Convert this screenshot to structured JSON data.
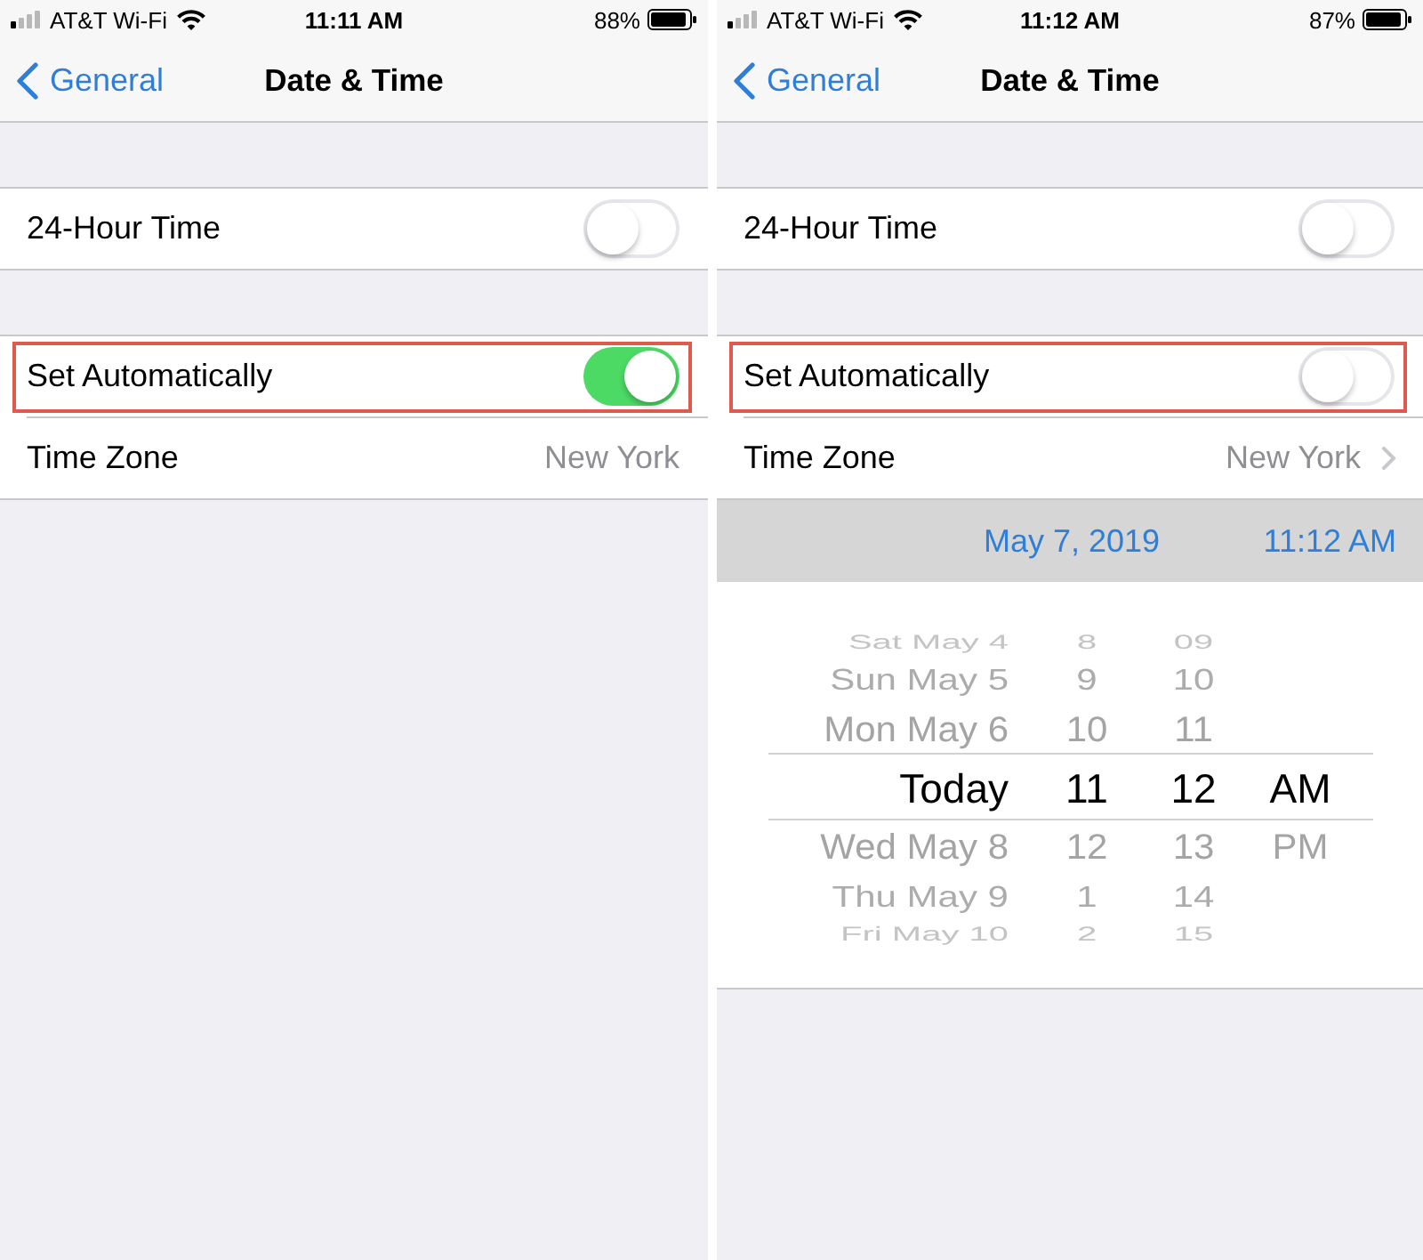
{
  "screens": [
    {
      "status_bar": {
        "carrier": "AT&T Wi-Fi",
        "time": "11:11 AM",
        "battery": "88%"
      },
      "nav_bar": {
        "back": "General",
        "title": "Date & Time"
      },
      "groups": [
        {
          "rows": [
            {
              "kind": "toggle",
              "label": "24-Hour Time",
              "on": false,
              "highlighted": false
            }
          ]
        },
        {
          "rows": [
            {
              "kind": "toggle",
              "label": "Set Automatically",
              "on": true,
              "highlighted": true
            },
            {
              "kind": "detail",
              "label": "Time Zone",
              "value": "New York",
              "chevron": false,
              "highlighted": false
            }
          ]
        }
      ]
    },
    {
      "status_bar": {
        "carrier": "AT&T Wi-Fi",
        "time": "11:12 AM",
        "battery": "87%"
      },
      "nav_bar": {
        "back": "General",
        "title": "Date & Time"
      },
      "groups": [
        {
          "rows": [
            {
              "kind": "toggle",
              "label": "24-Hour Time",
              "on": false,
              "highlighted": false
            }
          ]
        },
        {
          "rows": [
            {
              "kind": "toggle",
              "label": "Set Automatically",
              "on": false,
              "highlighted": true
            },
            {
              "kind": "detail",
              "label": "Time Zone",
              "value": "New York",
              "chevron": true,
              "highlighted": false
            }
          ]
        }
      ],
      "date_picker": {
        "date": "May 7, 2019",
        "time": "11:12 AM",
        "rows": [
          {
            "date": "Sat May 4",
            "hour": "8",
            "minute": "09",
            "selected": false
          },
          {
            "date": "Sun May 5",
            "hour": "9",
            "minute": "10",
            "selected": false
          },
          {
            "date": "Mon May 6",
            "hour": "10",
            "minute": "11",
            "selected": false
          },
          {
            "date": "Today",
            "hour": "11",
            "minute": "12",
            "period": "AM",
            "selected": true
          },
          {
            "date": "Wed May 8",
            "hour": "12",
            "minute": "13",
            "period": "PM",
            "selected": false
          },
          {
            "date": "Thu May 9",
            "hour": "1",
            "minute": "14",
            "selected": false
          },
          {
            "date": "Fri May 10",
            "hour": "2",
            "minute": "15",
            "selected": false
          }
        ]
      }
    }
  ]
}
